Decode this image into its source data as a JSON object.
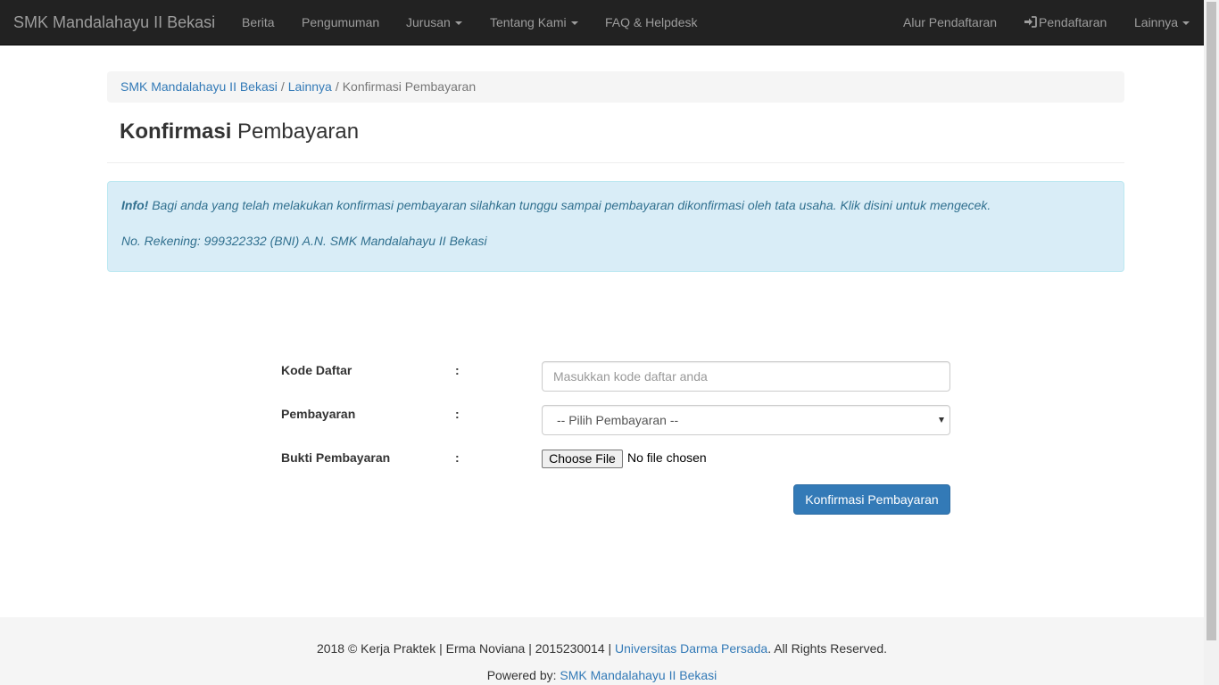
{
  "navbar": {
    "brand": "SMK Mandalahayu II Bekasi",
    "items": [
      "Berita",
      "Pengumuman",
      "Jurusan",
      "Tentang Kami",
      "FAQ & Helpdesk"
    ],
    "right_items": [
      "Alur Pendaftaran",
      "Pendaftaran",
      "Lainnya"
    ]
  },
  "breadcrumb": {
    "home": "SMK Mandalahayu II Bekasi",
    "parent": "Lainnya",
    "current": "Konfirmasi Pembayaran",
    "separator": "/"
  },
  "page": {
    "title_bold": "Konfirmasi",
    "title_rest": " Pembayaran"
  },
  "alert": {
    "strong": "Info!",
    "text_before": " Bagi anda yang telah melakukan konfirmasi pembayaran silahkan tunggu sampai pembayaran dikonfirmasi oleh tata usaha. Klik ",
    "link": "disini",
    "text_after": " untuk mengecek.",
    "account": "No. Rekening: 999322332 (BNI) A.N. SMK Mandalahayu II Bekasi"
  },
  "form": {
    "colon": ":",
    "kode_label": "Kode Daftar",
    "kode_placeholder": "Masukkan kode daftar anda",
    "pembayaran_label": "Pembayaran",
    "pembayaran_selected": "-- Pilih Pembayaran --",
    "bukti_label": "Bukti Pembayaran",
    "file_button": "Choose File",
    "file_status": "No file chosen",
    "submit": "Konfirmasi Pembayaran"
  },
  "footer": {
    "line1_before": "2018 © Kerja Praktek | Erma Noviana | 2015230014 | ",
    "line1_link": "Universitas Darma Persada",
    "line1_after": ". All Rights Reserved.",
    "line2_before": "Powered by: ",
    "line2_link": "SMK Mandalahayu II Bekasi"
  },
  "colors": {
    "navbar_bg": "#222222",
    "link": "#337ab7",
    "alert_bg": "#d9edf7",
    "alert_text": "#31708f",
    "primary_button": "#337ab7"
  }
}
